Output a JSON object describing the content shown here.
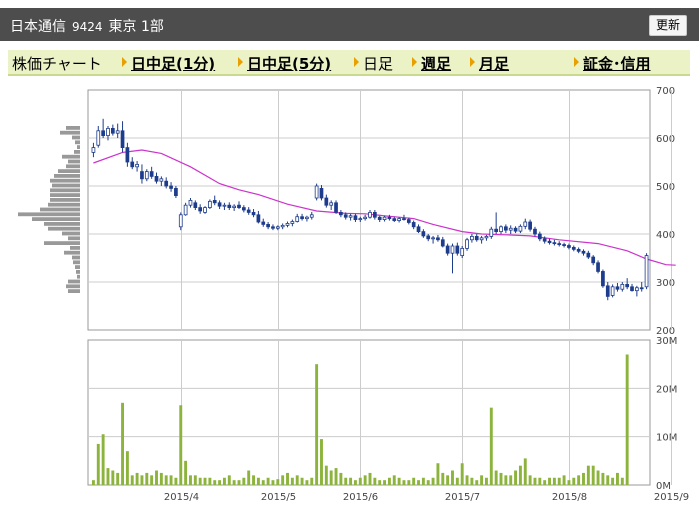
{
  "header": {
    "company": "日本通信",
    "code": "9424",
    "market": "東京 1部",
    "refresh_label": "更新"
  },
  "tabs": [
    {
      "label": "株価チャート",
      "link": false,
      "arrow": false
    },
    {
      "label": "日中足(1分)",
      "link": true,
      "arrow": true
    },
    {
      "label": "日中足(5分)",
      "link": true,
      "arrow": true
    },
    {
      "label": "日足",
      "link": false,
      "arrow": true
    },
    {
      "label": "週足",
      "link": true,
      "arrow": true
    },
    {
      "label": "月足",
      "link": true,
      "arrow": true
    },
    {
      "label": "証金･信用",
      "link": true,
      "arrow": true
    }
  ],
  "chart_data": {
    "type": "candlestick",
    "colors": {
      "up": "#ffffff",
      "down": "#1e3c8c",
      "outline": "#1e3c8c",
      "ma": "#cc33cc",
      "volume": "#8cb43c",
      "profile": "#999999",
      "grid": "#cccccc"
    },
    "price_axis": {
      "ylim": [
        200,
        700
      ],
      "ticks": [
        200,
        300,
        400,
        500,
        600,
        700
      ]
    },
    "volume_axis": {
      "ylim": [
        0,
        30
      ],
      "ticks": [
        "0M",
        "10M",
        "20M",
        "30M"
      ]
    },
    "x_labels": [
      {
        "label": "2015/4",
        "index": 18
      },
      {
        "label": "2015/5",
        "index": 38
      },
      {
        "label": "2015/6",
        "index": 55
      },
      {
        "label": "2015/7",
        "index": 76
      },
      {
        "label": "2015/8",
        "index": 98
      },
      {
        "label": "2015/9",
        "index": 119
      }
    ],
    "candles": [
      {
        "o": 570,
        "h": 590,
        "l": 560,
        "c": 580
      },
      {
        "o": 585,
        "h": 625,
        "l": 580,
        "c": 615
      },
      {
        "o": 615,
        "h": 640,
        "l": 600,
        "c": 605
      },
      {
        "o": 605,
        "h": 625,
        "l": 595,
        "c": 620
      },
      {
        "o": 620,
        "h": 628,
        "l": 605,
        "c": 610
      },
      {
        "o": 610,
        "h": 630,
        "l": 600,
        "c": 615
      },
      {
        "o": 615,
        "h": 635,
        "l": 570,
        "c": 580
      },
      {
        "o": 580,
        "h": 590,
        "l": 540,
        "c": 550
      },
      {
        "o": 550,
        "h": 560,
        "l": 535,
        "c": 540
      },
      {
        "o": 540,
        "h": 552,
        "l": 530,
        "c": 545
      },
      {
        "o": 530,
        "h": 545,
        "l": 505,
        "c": 515
      },
      {
        "o": 515,
        "h": 535,
        "l": 510,
        "c": 530
      },
      {
        "o": 530,
        "h": 540,
        "l": 515,
        "c": 520
      },
      {
        "o": 520,
        "h": 528,
        "l": 505,
        "c": 510
      },
      {
        "o": 510,
        "h": 520,
        "l": 500,
        "c": 515
      },
      {
        "o": 510,
        "h": 518,
        "l": 495,
        "c": 500
      },
      {
        "o": 500,
        "h": 508,
        "l": 488,
        "c": 495
      },
      {
        "o": 495,
        "h": 500,
        "l": 475,
        "c": 480
      },
      {
        "o": 415,
        "h": 445,
        "l": 408,
        "c": 440
      },
      {
        "o": 440,
        "h": 465,
        "l": 438,
        "c": 460
      },
      {
        "o": 460,
        "h": 475,
        "l": 455,
        "c": 470
      },
      {
        "o": 465,
        "h": 470,
        "l": 450,
        "c": 455
      },
      {
        "o": 455,
        "h": 462,
        "l": 442,
        "c": 448
      },
      {
        "o": 445,
        "h": 458,
        "l": 442,
        "c": 455
      },
      {
        "o": 455,
        "h": 472,
        "l": 452,
        "c": 468
      },
      {
        "o": 470,
        "h": 480,
        "l": 460,
        "c": 465
      },
      {
        "o": 465,
        "h": 470,
        "l": 452,
        "c": 458
      },
      {
        "o": 458,
        "h": 465,
        "l": 450,
        "c": 460
      },
      {
        "o": 460,
        "h": 466,
        "l": 450,
        "c": 455
      },
      {
        "o": 455,
        "h": 462,
        "l": 448,
        "c": 458
      },
      {
        "o": 460,
        "h": 468,
        "l": 452,
        "c": 455
      },
      {
        "o": 455,
        "h": 460,
        "l": 445,
        "c": 450
      },
      {
        "o": 450,
        "h": 456,
        "l": 440,
        "c": 445
      },
      {
        "o": 445,
        "h": 452,
        "l": 435,
        "c": 440
      },
      {
        "o": 440,
        "h": 448,
        "l": 422,
        "c": 425
      },
      {
        "o": 425,
        "h": 432,
        "l": 415,
        "c": 420
      },
      {
        "o": 420,
        "h": 425,
        "l": 410,
        "c": 415
      },
      {
        "o": 415,
        "h": 420,
        "l": 408,
        "c": 412
      },
      {
        "o": 412,
        "h": 418,
        "l": 408,
        "c": 415
      },
      {
        "o": 415,
        "h": 422,
        "l": 410,
        "c": 418
      },
      {
        "o": 418,
        "h": 426,
        "l": 414,
        "c": 422
      },
      {
        "o": 422,
        "h": 430,
        "l": 416,
        "c": 426
      },
      {
        "o": 426,
        "h": 442,
        "l": 424,
        "c": 436
      },
      {
        "o": 436,
        "h": 442,
        "l": 428,
        "c": 432
      },
      {
        "o": 432,
        "h": 438,
        "l": 426,
        "c": 435
      },
      {
        "o": 435,
        "h": 446,
        "l": 430,
        "c": 440
      },
      {
        "o": 475,
        "h": 505,
        "l": 470,
        "c": 500
      },
      {
        "o": 495,
        "h": 502,
        "l": 470,
        "c": 475
      },
      {
        "o": 475,
        "h": 482,
        "l": 455,
        "c": 460
      },
      {
        "o": 460,
        "h": 470,
        "l": 450,
        "c": 465
      },
      {
        "o": 465,
        "h": 470,
        "l": 442,
        "c": 445
      },
      {
        "o": 445,
        "h": 450,
        "l": 435,
        "c": 440
      },
      {
        "o": 440,
        "h": 445,
        "l": 430,
        "c": 435
      },
      {
        "o": 435,
        "h": 442,
        "l": 428,
        "c": 438
      },
      {
        "o": 438,
        "h": 442,
        "l": 425,
        "c": 430
      },
      {
        "o": 430,
        "h": 436,
        "l": 425,
        "c": 432
      },
      {
        "o": 432,
        "h": 440,
        "l": 428,
        "c": 435
      },
      {
        "o": 435,
        "h": 450,
        "l": 432,
        "c": 445
      },
      {
        "o": 445,
        "h": 450,
        "l": 430,
        "c": 435
      },
      {
        "o": 435,
        "h": 438,
        "l": 425,
        "c": 430
      },
      {
        "o": 430,
        "h": 438,
        "l": 426,
        "c": 435
      },
      {
        "o": 435,
        "h": 440,
        "l": 428,
        "c": 432
      },
      {
        "o": 432,
        "h": 436,
        "l": 425,
        "c": 428
      },
      {
        "o": 428,
        "h": 435,
        "l": 424,
        "c": 432
      },
      {
        "o": 432,
        "h": 440,
        "l": 428,
        "c": 430
      },
      {
        "o": 430,
        "h": 434,
        "l": 420,
        "c": 424
      },
      {
        "o": 424,
        "h": 428,
        "l": 410,
        "c": 415
      },
      {
        "o": 415,
        "h": 420,
        "l": 402,
        "c": 405
      },
      {
        "o": 405,
        "h": 410,
        "l": 392,
        "c": 396
      },
      {
        "o": 396,
        "h": 400,
        "l": 385,
        "c": 390
      },
      {
        "o": 390,
        "h": 396,
        "l": 380,
        "c": 392
      },
      {
        "o": 392,
        "h": 398,
        "l": 384,
        "c": 388
      },
      {
        "o": 388,
        "h": 394,
        "l": 372,
        "c": 375
      },
      {
        "o": 375,
        "h": 380,
        "l": 355,
        "c": 360
      },
      {
        "o": 360,
        "h": 380,
        "l": 318,
        "c": 375
      },
      {
        "o": 375,
        "h": 382,
        "l": 355,
        "c": 360
      },
      {
        "o": 355,
        "h": 375,
        "l": 350,
        "c": 370
      },
      {
        "o": 370,
        "h": 392,
        "l": 365,
        "c": 388
      },
      {
        "o": 388,
        "h": 400,
        "l": 382,
        "c": 395
      },
      {
        "o": 395,
        "h": 400,
        "l": 384,
        "c": 388
      },
      {
        "o": 388,
        "h": 396,
        "l": 380,
        "c": 392
      },
      {
        "o": 392,
        "h": 398,
        "l": 386,
        "c": 395
      },
      {
        "o": 395,
        "h": 415,
        "l": 390,
        "c": 410
      },
      {
        "o": 410,
        "h": 445,
        "l": 400,
        "c": 405
      },
      {
        "o": 405,
        "h": 418,
        "l": 400,
        "c": 415
      },
      {
        "o": 415,
        "h": 420,
        "l": 402,
        "c": 408
      },
      {
        "o": 408,
        "h": 418,
        "l": 400,
        "c": 412
      },
      {
        "o": 412,
        "h": 416,
        "l": 402,
        "c": 406
      },
      {
        "o": 406,
        "h": 420,
        "l": 402,
        "c": 416
      },
      {
        "o": 416,
        "h": 432,
        "l": 410,
        "c": 425
      },
      {
        "o": 425,
        "h": 430,
        "l": 405,
        "c": 410
      },
      {
        "o": 410,
        "h": 415,
        "l": 395,
        "c": 400
      },
      {
        "o": 400,
        "h": 405,
        "l": 385,
        "c": 390
      },
      {
        "o": 390,
        "h": 395,
        "l": 380,
        "c": 385
      },
      {
        "o": 385,
        "h": 390,
        "l": 378,
        "c": 382
      },
      {
        "o": 382,
        "h": 388,
        "l": 376,
        "c": 380
      },
      {
        "o": 380,
        "h": 385,
        "l": 374,
        "c": 378
      },
      {
        "o": 378,
        "h": 382,
        "l": 372,
        "c": 376
      },
      {
        "o": 376,
        "h": 380,
        "l": 368,
        "c": 372
      },
      {
        "o": 372,
        "h": 376,
        "l": 364,
        "c": 368
      },
      {
        "o": 368,
        "h": 372,
        "l": 360,
        "c": 364
      },
      {
        "o": 364,
        "h": 368,
        "l": 355,
        "c": 360
      },
      {
        "o": 360,
        "h": 365,
        "l": 348,
        "c": 352
      },
      {
        "o": 352,
        "h": 356,
        "l": 335,
        "c": 340
      },
      {
        "o": 340,
        "h": 345,
        "l": 318,
        "c": 322
      },
      {
        "o": 322,
        "h": 326,
        "l": 288,
        "c": 292
      },
      {
        "o": 292,
        "h": 300,
        "l": 262,
        "c": 270
      },
      {
        "o": 272,
        "h": 295,
        "l": 268,
        "c": 290
      },
      {
        "o": 290,
        "h": 298,
        "l": 280,
        "c": 285
      },
      {
        "o": 285,
        "h": 300,
        "l": 280,
        "c": 295
      },
      {
        "o": 295,
        "h": 308,
        "l": 285,
        "c": 290
      },
      {
        "o": 290,
        "h": 296,
        "l": 280,
        "c": 282
      },
      {
        "o": 282,
        "h": 292,
        "l": 270,
        "c": 288
      },
      {
        "o": 288,
        "h": 300,
        "l": 280,
        "c": 286
      },
      {
        "o": 290,
        "h": 360,
        "l": 285,
        "c": 355
      }
    ],
    "ma": [
      {
        "i": 0,
        "v": 548
      },
      {
        "i": 6,
        "v": 570
      },
      {
        "i": 10,
        "v": 575
      },
      {
        "i": 14,
        "v": 568
      },
      {
        "i": 20,
        "v": 540
      },
      {
        "i": 26,
        "v": 505
      },
      {
        "i": 30,
        "v": 492
      },
      {
        "i": 34,
        "v": 482
      },
      {
        "i": 40,
        "v": 462
      },
      {
        "i": 46,
        "v": 448
      },
      {
        "i": 52,
        "v": 443
      },
      {
        "i": 56,
        "v": 442
      },
      {
        "i": 60,
        "v": 438
      },
      {
        "i": 66,
        "v": 432
      },
      {
        "i": 70,
        "v": 420
      },
      {
        "i": 76,
        "v": 405
      },
      {
        "i": 80,
        "v": 400
      },
      {
        "i": 86,
        "v": 398
      },
      {
        "i": 90,
        "v": 396
      },
      {
        "i": 96,
        "v": 388
      },
      {
        "i": 104,
        "v": 380
      },
      {
        "i": 110,
        "v": 365
      },
      {
        "i": 114,
        "v": 348
      },
      {
        "i": 118,
        "v": 336
      },
      {
        "i": 120,
        "v": 335
      }
    ],
    "volume": [
      1,
      8.5,
      10.5,
      3.5,
      3,
      2.5,
      17,
      7,
      2,
      2.5,
      2,
      2.5,
      2,
      3,
      2.5,
      2,
      2,
      1.5,
      16.5,
      5,
      2,
      2,
      1.5,
      1.5,
      1.5,
      1,
      1,
      1.5,
      2,
      1,
      1,
      1.5,
      3,
      2,
      1.5,
      1,
      1.5,
      1,
      1.2,
      2,
      2.5,
      1.5,
      2,
      1.5,
      1,
      1.5,
      25,
      9.5,
      4,
      3,
      3.5,
      2.5,
      1.5,
      1.5,
      1,
      1.5,
      2,
      2.5,
      1.5,
      1,
      1,
      1.5,
      2,
      1.5,
      1,
      1,
      1.5,
      1,
      1.5,
      1,
      1.5,
      4.5,
      2.5,
      2,
      3,
      1.5,
      4.5,
      2,
      1.5,
      1,
      2,
      1.5,
      16,
      3,
      2.5,
      2,
      2,
      3,
      4,
      5.5,
      2,
      1.5,
      1.5,
      1,
      1.5,
      1.5,
      1.5,
      2,
      1,
      1.5,
      2,
      2.5,
      4,
      4,
      3,
      2.5,
      2,
      1.5,
      2.5,
      1.5,
      27
    ],
    "volume_profile": [
      {
        "p": 620,
        "w": 14
      },
      {
        "p": 610,
        "w": 20
      },
      {
        "p": 600,
        "w": 8
      },
      {
        "p": 590,
        "w": 5
      },
      {
        "p": 580,
        "w": 3
      },
      {
        "p": 570,
        "w": 6
      },
      {
        "p": 560,
        "w": 18
      },
      {
        "p": 550,
        "w": 12
      },
      {
        "p": 540,
        "w": 14
      },
      {
        "p": 530,
        "w": 22
      },
      {
        "p": 520,
        "w": 26
      },
      {
        "p": 510,
        "w": 30
      },
      {
        "p": 500,
        "w": 28
      },
      {
        "p": 490,
        "w": 30
      },
      {
        "p": 480,
        "w": 30
      },
      {
        "p": 470,
        "w": 30
      },
      {
        "p": 460,
        "w": 32
      },
      {
        "p": 450,
        "w": 40
      },
      {
        "p": 440,
        "w": 62
      },
      {
        "p": 430,
        "w": 48
      },
      {
        "p": 420,
        "w": 36
      },
      {
        "p": 410,
        "w": 32
      },
      {
        "p": 400,
        "w": 18
      },
      {
        "p": 390,
        "w": 12
      },
      {
        "p": 380,
        "w": 36
      },
      {
        "p": 370,
        "w": 10
      },
      {
        "p": 360,
        "w": 16
      },
      {
        "p": 350,
        "w": 8
      },
      {
        "p": 340,
        "w": 7
      },
      {
        "p": 330,
        "w": 5
      },
      {
        "p": 320,
        "w": 4
      },
      {
        "p": 310,
        "w": 3
      },
      {
        "p": 300,
        "w": 12
      },
      {
        "p": 290,
        "w": 14
      },
      {
        "p": 280,
        "w": 12
      }
    ]
  }
}
